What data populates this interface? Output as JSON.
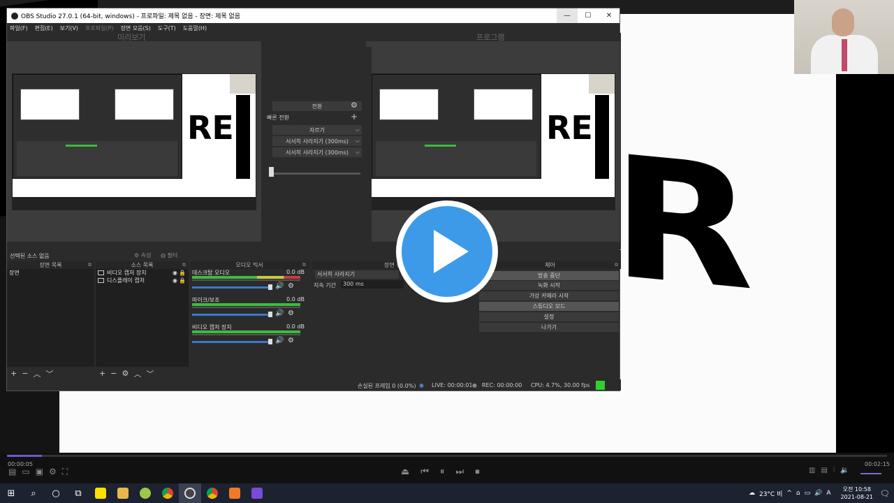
{
  "obs": {
    "title": "OBS Studio 27.0.1 (64-bit, windows) - 프로파일: 제목 없음 - 장면: 제목 없음",
    "menu": [
      "파일(F)",
      "편집(E)",
      "보기(V)",
      "프로파일(P)",
      "장면 모음(S)",
      "도구(T)",
      "도움말(H)"
    ],
    "preview_label": "미리보기",
    "program_label": "프로그램",
    "transition": {
      "header": "전환",
      "quick": "빠른 전환",
      "cut": "자르기",
      "fade1": "서서히 사라지기 (300ms)",
      "fade2": "서서히 사라지기 (300ms)"
    },
    "source_bar": {
      "none_selected": "선택된 소스 없음",
      "properties": "속성",
      "filters": "필터"
    },
    "docks": {
      "scenes_title": "장면 목록",
      "scene_item": "장면",
      "sources_title": "소스 목록",
      "sources": [
        "비디오 캡처 장치",
        "디스플레이 캡처"
      ],
      "mixer_title": "오디오 믹서",
      "channels": [
        {
          "name": "데스크탑 오디오",
          "db": "0.0 dB"
        },
        {
          "name": "마이크/보조",
          "db": "0.0 dB"
        },
        {
          "name": "비디오 캡처 장치",
          "db": "0.0 dB"
        }
      ],
      "transitions_title": "장면 전환",
      "transition_value": "서서히 사라지기",
      "duration_label": "지속 기간",
      "duration_value": "300 ms",
      "controls_title": "제어",
      "controls": [
        "방송 중단",
        "녹화 시작",
        "가상 카메라 시작",
        "스튜디오 모드",
        "설정",
        "나가기"
      ]
    },
    "status": {
      "dropped": "손실된 프레임 0 (0.0%)",
      "live": "LIVE: 00:00:01",
      "rec": "REC: 00:00:00",
      "cpu": "CPU: 4.7%, 30.00 fps"
    }
  },
  "player": {
    "current_time": "00:00:05",
    "total_time": "00:02:15",
    "progress_fraction": 0.04
  },
  "taskbar": {
    "weather": "23°C 비",
    "ime": "A",
    "time": "오전 10:58",
    "date": "2021-08-21"
  }
}
